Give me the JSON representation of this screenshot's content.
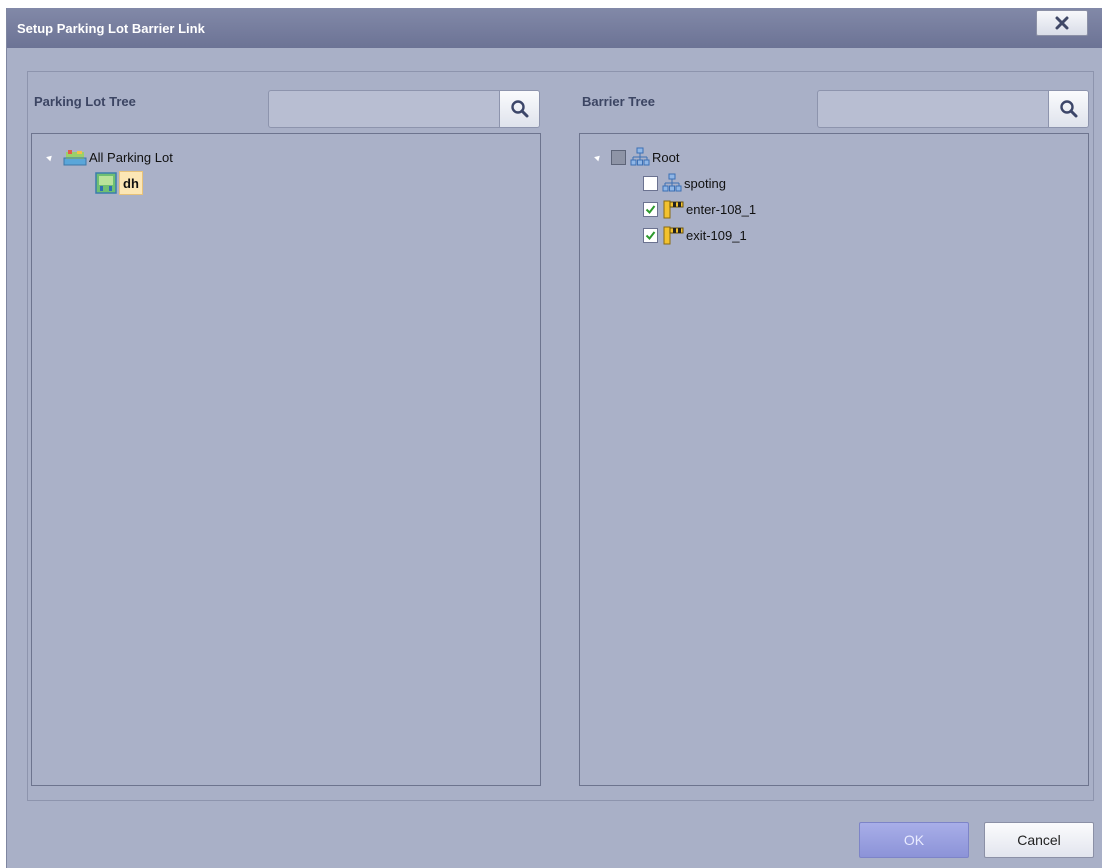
{
  "dialog": {
    "title": "Setup Parking Lot Barrier Link"
  },
  "parking_panel": {
    "label": "Parking Lot Tree",
    "search_value": "",
    "tree": [
      {
        "label": "All Parking Lot",
        "icon": "parking-lot-group-icon",
        "expanded": true
      },
      {
        "label": "dh",
        "icon": "parking-lot-icon",
        "selected": true
      }
    ]
  },
  "barrier_panel": {
    "label": "Barrier Tree",
    "search_value": "",
    "tree": [
      {
        "label": "Root",
        "icon": "org-tree-icon",
        "checked": "partial",
        "expanded": true
      },
      {
        "label": "spoting",
        "icon": "org-tree-icon",
        "checked": "unchecked"
      },
      {
        "label": "enter-108_1",
        "icon": "barrier-gate-icon",
        "checked": "checked"
      },
      {
        "label": "exit-109_1",
        "icon": "barrier-gate-icon",
        "checked": "checked"
      }
    ]
  },
  "buttons": {
    "ok": "OK",
    "cancel": "Cancel"
  },
  "colors": {
    "titlebar": "#6c7395",
    "dialog_bg": "#a9b0c7",
    "selection_bg": "#fce6b5",
    "ok_button": "#8c93d8"
  }
}
